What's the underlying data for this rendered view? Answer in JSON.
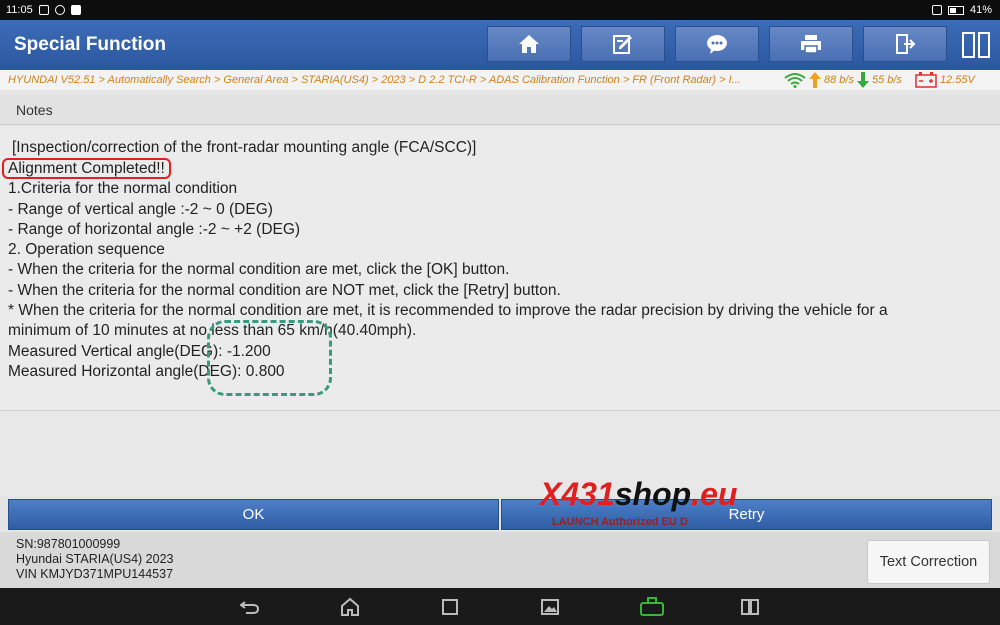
{
  "status_bar": {
    "time": "11:05",
    "battery": "41%"
  },
  "app": {
    "title": "Special Function"
  },
  "toolbar": {
    "buttons": [
      {
        "name": "home-icon"
      },
      {
        "name": "edit-icon"
      },
      {
        "name": "message-icon"
      },
      {
        "name": "print-icon"
      },
      {
        "name": "exit-icon"
      }
    ],
    "split_icon": "split-view-icon"
  },
  "breadcrumb": {
    "path": "HYUNDAI V52.51 > Automatically Search > General Area > STARIA(US4) > 2023 > D 2.2 TCI-R > ADAS Calibration Function > FR (Front Radar) > I...",
    "upload": "88 b/s",
    "download": "55 b/s",
    "voltage": "12.55V"
  },
  "notes": {
    "header": "Notes",
    "lines": [
      "[Inspection/correction of the front-radar mounting angle (FCA/SCC)]",
      "Alignment Completed!!",
      "1.Criteria for the normal condition",
      " - Range of vertical angle :-2 ~ 0 (DEG)",
      " - Range of horizontal angle :-2 ~ +2 (DEG)",
      "2. Operation sequence",
      " - When the criteria for the normal condition are met, click the [OK] button.",
      " - When the criteria for the normal condition are NOT met, click the [Retry] button.",
      "* When the criteria for the normal condition are met, it is recommended to improve the radar precision by driving the vehicle for a",
      "minimum of 10 minutes at no less than 65 km/h(40.40mph).",
      "Measured Vertical angle(DEG): -1.200",
      "Measured Horizontal angle(DEG): 0.800"
    ]
  },
  "actions": {
    "ok": "OK",
    "retry": "Retry"
  },
  "vehicle": {
    "sn": "SN:987801000999",
    "model": "Hyundai STARIA(US4) 2023",
    "vin": "VIN KMJYD371MPU144537"
  },
  "text_correction": "Text Correction",
  "watermark": {
    "x": "X",
    "n431": "431",
    "shop": "shop",
    "eu": ".eu",
    "sub": "LAUNCH Authorized EU D"
  },
  "colors": {
    "title_bar": "#2f5ea6",
    "accent_orange": "#d0801a",
    "highlight_red": "#e02020",
    "dashed_green": "#3a9a7e"
  }
}
